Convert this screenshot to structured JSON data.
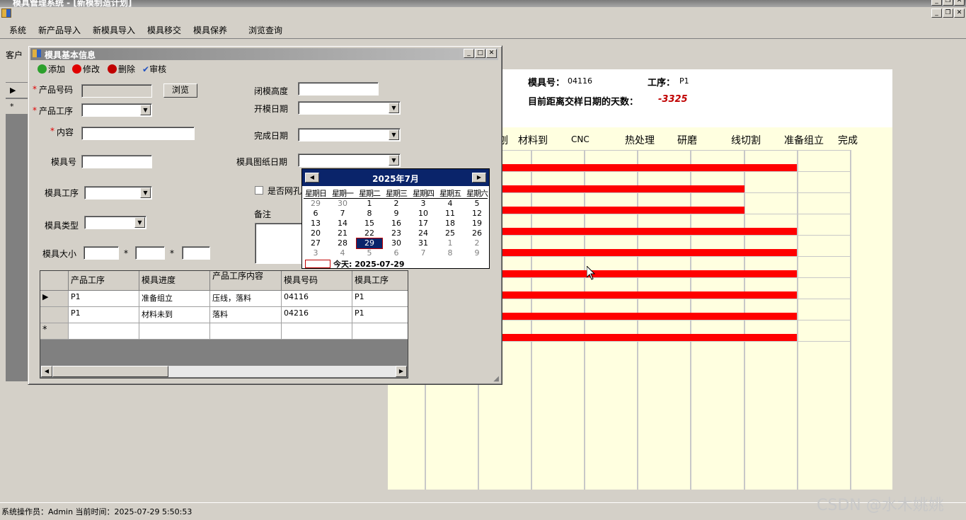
{
  "window": {
    "title": "模具管理系统 - [新模制造计划]"
  },
  "menu": {
    "items": [
      "系统",
      "新产品导入",
      "新模具导入",
      "模具移交",
      "模具保养",
      "浏览查询"
    ]
  },
  "back": {
    "client_label": "客户",
    "mold_no_label": "模具号：",
    "mold_no": "04116",
    "process_label": "工序：",
    "process": "P1",
    "days_label": "目前距离交样日期的天数：",
    "days_value": "-3325",
    "columns": [
      "刨",
      "材料到",
      "CNC",
      "热处理",
      "研磨",
      "线切割",
      "准备组立",
      "完成"
    ]
  },
  "dialog": {
    "title": "模具基本信息",
    "toolbar": {
      "add": "添加",
      "edit": "修改",
      "delete": "删除",
      "audit": "审核"
    },
    "fields": {
      "product_no": "产品号码",
      "product_process": "产品工序",
      "content": "内容",
      "mold_no": "模具号",
      "mold_process": "模具工序",
      "mold_type": "模具类型",
      "mold_size": "模具大小",
      "close_height": "闭模高度",
      "open_date": "开模日期",
      "finish_date": "完成日期",
      "drawing_date": "模具图纸日期",
      "is_mesh": "是否网孔",
      "remark": "备注",
      "browse_btn": "浏览",
      "times1": "*",
      "times2": "*",
      "req_mark": "*"
    },
    "grid": {
      "headers": [
        "产品工序",
        "模具进度",
        "产品工序内容",
        "模具号码",
        "模具工序"
      ],
      "rows": [
        [
          "P1",
          "准备组立",
          "压线，落料",
          "04116",
          "P1"
        ],
        [
          "P1",
          "材料未到",
          "落料",
          "04216",
          "P1"
        ]
      ],
      "new_row_marker": "*",
      "current_row_marker": "▶"
    }
  },
  "calendar": {
    "month_title": "2025年7月",
    "weekdays": [
      "星期日",
      "星期一",
      "星期二",
      "星期三",
      "星期四",
      "星期五",
      "星期六"
    ],
    "weeks": [
      [
        "29",
        "30",
        "1",
        "2",
        "3",
        "4",
        "5"
      ],
      [
        "6",
        "7",
        "8",
        "9",
        "10",
        "11",
        "12"
      ],
      [
        "13",
        "14",
        "15",
        "16",
        "17",
        "18",
        "19"
      ],
      [
        "20",
        "21",
        "22",
        "23",
        "24",
        "25",
        "26"
      ],
      [
        "27",
        "28",
        "29",
        "30",
        "31",
        "1",
        "2"
      ],
      [
        "3",
        "4",
        "5",
        "6",
        "7",
        "8",
        "9"
      ]
    ],
    "selected": "29",
    "today_label": "今天: 2025-07-29"
  },
  "status": {
    "text": "系统操作员：Admin 当前时间：2025-07-29 5:50:53"
  },
  "watermark": "CSDN @水木姚姚",
  "colors": {
    "accent": "#0a246a",
    "bar": "#ff0000",
    "required": "#e00000",
    "days": "#c00000"
  }
}
